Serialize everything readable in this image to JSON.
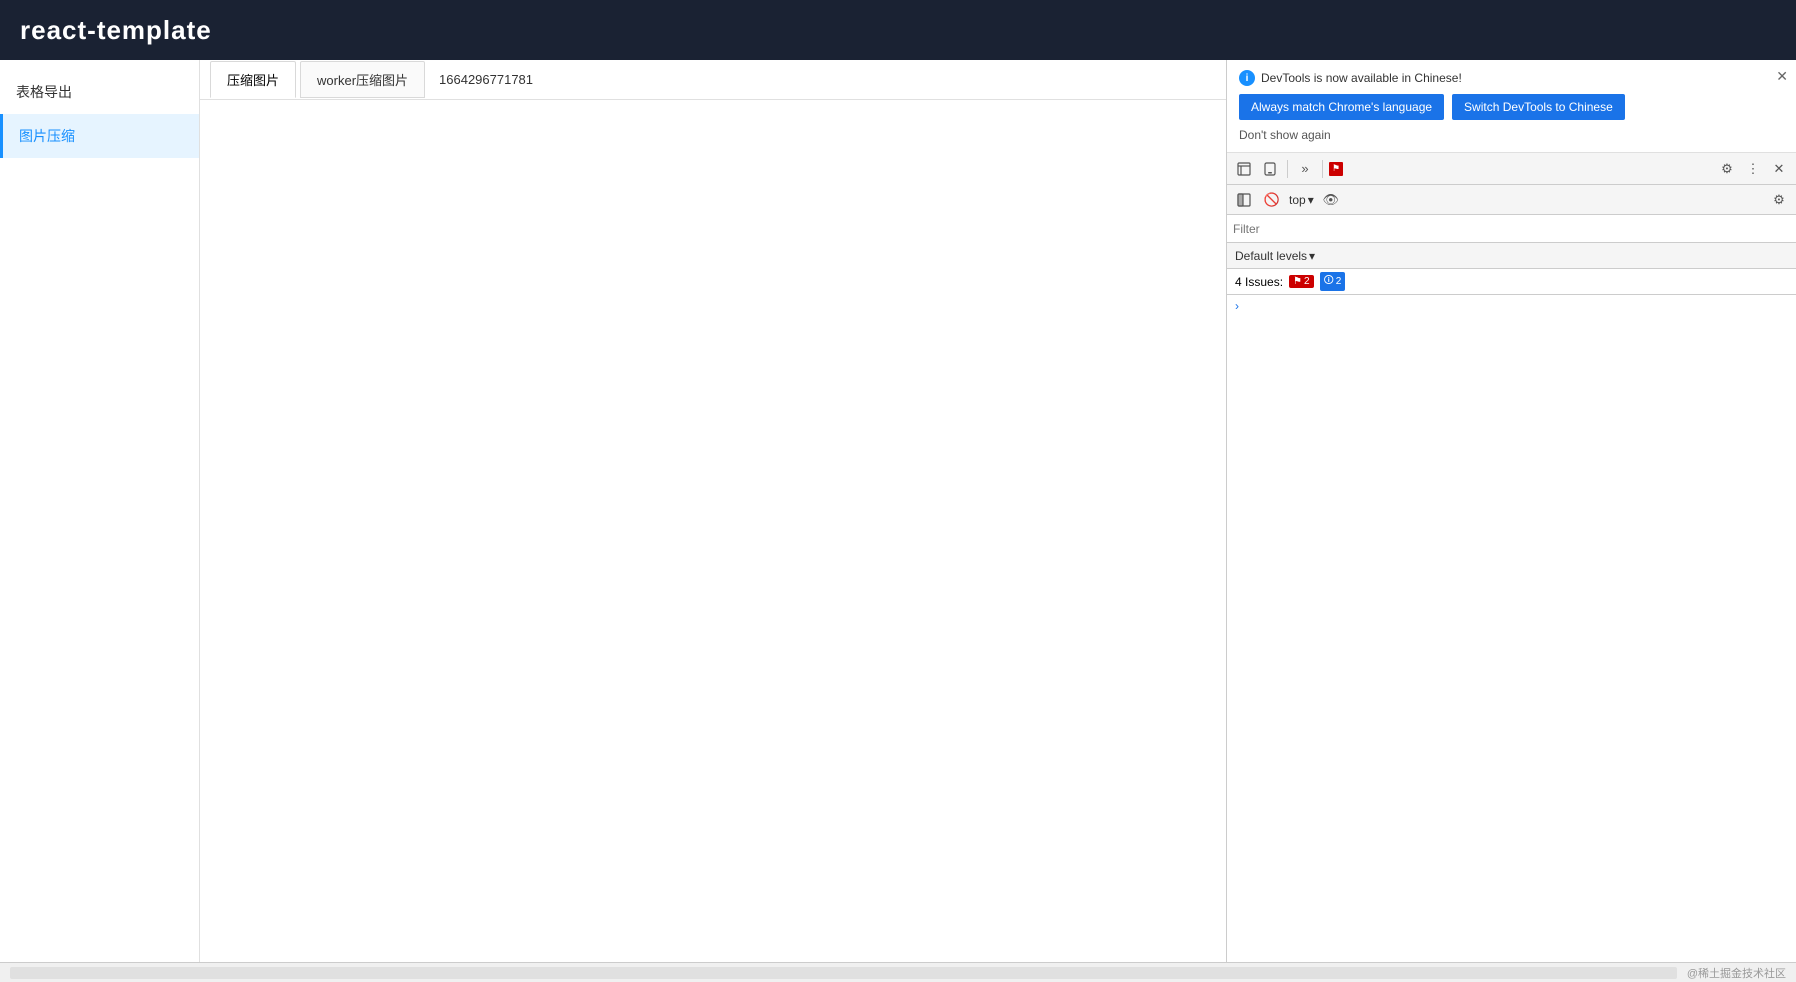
{
  "app": {
    "title": "react-template"
  },
  "sidebar": {
    "items": [
      {
        "id": "table-export",
        "label": "表格导出",
        "active": false
      },
      {
        "id": "image-compress",
        "label": "图片压缩",
        "active": true
      }
    ]
  },
  "tabs": {
    "items": [
      {
        "id": "compress-tab",
        "label": "压缩图片",
        "active": true
      },
      {
        "id": "worker-tab",
        "label": "worker压缩图片",
        "active": false
      }
    ],
    "timestamp": "1664296771781"
  },
  "footer": {
    "credit": "@稀土掘金技术社区"
  },
  "devtools": {
    "notification": {
      "message": "DevTools is now available in Chinese!",
      "btn_primary": "Always match Chrome's language",
      "btn_secondary": "Switch DevTools to Chinese",
      "dont_show": "Don't show again"
    },
    "toolbar": {
      "icons": [
        "⇦⊡",
        "⧉",
        "»",
        "⚑",
        "⚙",
        "⋮",
        "✕"
      ]
    },
    "toolbar2": {
      "top_label": "top",
      "eye_icon": "👁"
    },
    "filter": {
      "placeholder": "Filter"
    },
    "levels": {
      "label": "Default levels",
      "arrow": "▾"
    },
    "issues": {
      "label": "4 Issues:",
      "error_count": "2",
      "warn_count": "2"
    }
  }
}
